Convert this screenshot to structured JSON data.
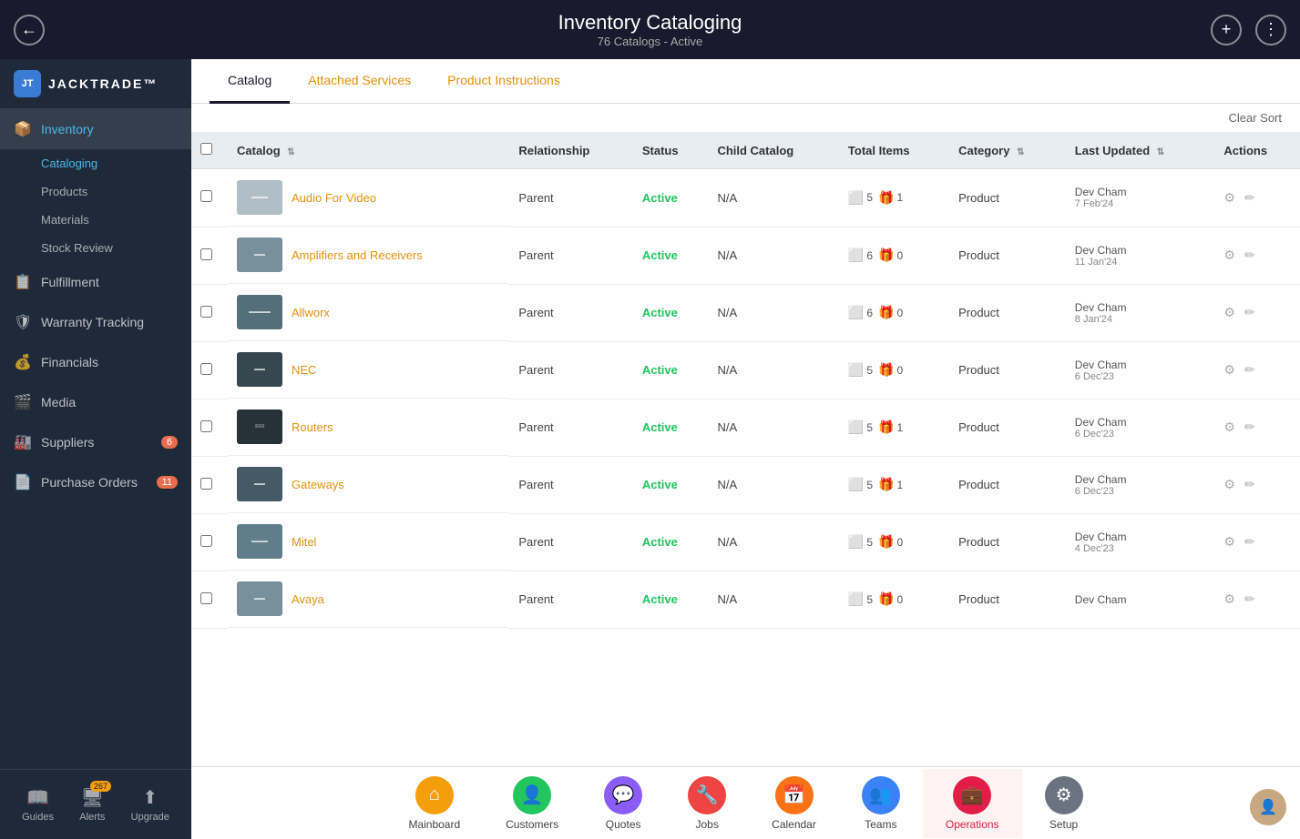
{
  "header": {
    "title": "Inventory Cataloging",
    "subtitle": "76 Catalogs - Active",
    "back_label": "←",
    "add_label": "+",
    "more_label": "⋮"
  },
  "logo": {
    "icon": "JT",
    "text": "JACKTRADE™"
  },
  "sidebar": {
    "items": [
      {
        "id": "inventory",
        "label": "Inventory",
        "icon": "📦",
        "active": true
      },
      {
        "id": "cataloging",
        "label": "Cataloging",
        "sub": true,
        "active": true
      },
      {
        "id": "products",
        "label": "Products",
        "sub": true
      },
      {
        "id": "materials",
        "label": "Materials",
        "sub": true
      },
      {
        "id": "stock-review",
        "label": "Stock Review",
        "sub": true
      },
      {
        "id": "fulfillment",
        "label": "Fulfillment",
        "icon": "📋"
      },
      {
        "id": "warranty",
        "label": "Warranty Tracking",
        "icon": "🛡"
      },
      {
        "id": "financials",
        "label": "Financials",
        "icon": "💰"
      },
      {
        "id": "media",
        "label": "Media",
        "icon": "🎬"
      },
      {
        "id": "suppliers",
        "label": "Suppliers",
        "icon": "🏭",
        "badge": "6"
      },
      {
        "id": "purchase-orders",
        "label": "Purchase Orders",
        "icon": "📄",
        "badge": "11"
      }
    ],
    "bottom": {
      "guides_label": "Guides",
      "alerts_label": "Alerts",
      "alerts_badge": "267",
      "upgrade_label": "Upgrade"
    }
  },
  "tabs": [
    {
      "id": "catalog",
      "label": "Catalog",
      "active": true
    },
    {
      "id": "attached-services",
      "label": "Attached Services",
      "orange": true
    },
    {
      "id": "product-instructions",
      "label": "Product Instructions",
      "orange": true
    }
  ],
  "table": {
    "clear_sort": "Clear Sort",
    "columns": [
      {
        "id": "catalog",
        "label": "Catalog",
        "sortable": true
      },
      {
        "id": "relationship",
        "label": "Relationship"
      },
      {
        "id": "status",
        "label": "Status"
      },
      {
        "id": "child-catalog",
        "label": "Child Catalog"
      },
      {
        "id": "total-items",
        "label": "Total Items"
      },
      {
        "id": "category",
        "label": "Category",
        "sortable": true
      },
      {
        "id": "last-updated",
        "label": "Last Updated",
        "sortable": true
      },
      {
        "id": "actions",
        "label": "Actions"
      }
    ],
    "rows": [
      {
        "id": 1,
        "name": "Audio For Video",
        "relationship": "Parent",
        "status": "Active",
        "child_catalog": "N/A",
        "items_box": "5",
        "items_gift": "1",
        "category": "Product",
        "updated_by": "Dev Cham",
        "updated_date": "7 Feb'24",
        "img_color": "#b0bec5"
      },
      {
        "id": 2,
        "name": "Amplifiers and Receivers",
        "relationship": "Parent",
        "status": "Active",
        "child_catalog": "N/A",
        "items_box": "6",
        "items_gift": "0",
        "category": "Product",
        "updated_by": "Dev Cham",
        "updated_date": "11 Jan'24",
        "img_color": "#78909c"
      },
      {
        "id": 3,
        "name": "Allworx",
        "relationship": "Parent",
        "status": "Active",
        "child_catalog": "N/A",
        "items_box": "6",
        "items_gift": "0",
        "category": "Product",
        "updated_by": "Dev Cham",
        "updated_date": "8 Jan'24",
        "img_color": "#546e7a"
      },
      {
        "id": 4,
        "name": "NEC",
        "relationship": "Parent",
        "status": "Active",
        "child_catalog": "N/A",
        "items_box": "5",
        "items_gift": "0",
        "category": "Product",
        "updated_by": "Dev Cham",
        "updated_date": "6 Dec'23",
        "img_color": "#37474f"
      },
      {
        "id": 5,
        "name": "Routers",
        "relationship": "Parent",
        "status": "Active",
        "child_catalog": "N/A",
        "items_box": "5",
        "items_gift": "1",
        "category": "Product",
        "updated_by": "Dev Cham",
        "updated_date": "6 Dec'23",
        "img_color": "#263238"
      },
      {
        "id": 6,
        "name": "Gateways",
        "relationship": "Parent",
        "status": "Active",
        "child_catalog": "N/A",
        "items_box": "5",
        "items_gift": "1",
        "category": "Product",
        "updated_by": "Dev Cham",
        "updated_date": "6 Dec'23",
        "img_color": "#455a64"
      },
      {
        "id": 7,
        "name": "Mitel",
        "relationship": "Parent",
        "status": "Active",
        "child_catalog": "N/A",
        "items_box": "5",
        "items_gift": "0",
        "category": "Product",
        "updated_by": "Dev Cham",
        "updated_date": "4 Dec'23",
        "img_color": "#607d8b"
      },
      {
        "id": 8,
        "name": "Avaya",
        "relationship": "Parent",
        "status": "Active",
        "child_catalog": "N/A",
        "items_box": "5",
        "items_gift": "0",
        "category": "Product",
        "updated_by": "Dev Cham",
        "updated_date": "",
        "img_color": "#78909c"
      }
    ]
  },
  "bottom_nav": {
    "items": [
      {
        "id": "mainboard",
        "label": "Mainboard",
        "icon": "⌂",
        "color": "#f59e0b"
      },
      {
        "id": "customers",
        "label": "Customers",
        "icon": "👤",
        "color": "#22c55e"
      },
      {
        "id": "quotes",
        "label": "Quotes",
        "icon": "💬",
        "color": "#8b5cf6"
      },
      {
        "id": "jobs",
        "label": "Jobs",
        "icon": "🔧",
        "color": "#ef4444"
      },
      {
        "id": "calendar",
        "label": "Calendar",
        "icon": "📅",
        "color": "#f97316"
      },
      {
        "id": "teams",
        "label": "Teams",
        "icon": "👥",
        "color": "#3b82f6"
      },
      {
        "id": "operations",
        "label": "Operations",
        "icon": "💼",
        "color": "#e11d48",
        "active": true
      },
      {
        "id": "setup",
        "label": "Setup",
        "icon": "⚙",
        "color": "#6b7280"
      }
    ]
  }
}
